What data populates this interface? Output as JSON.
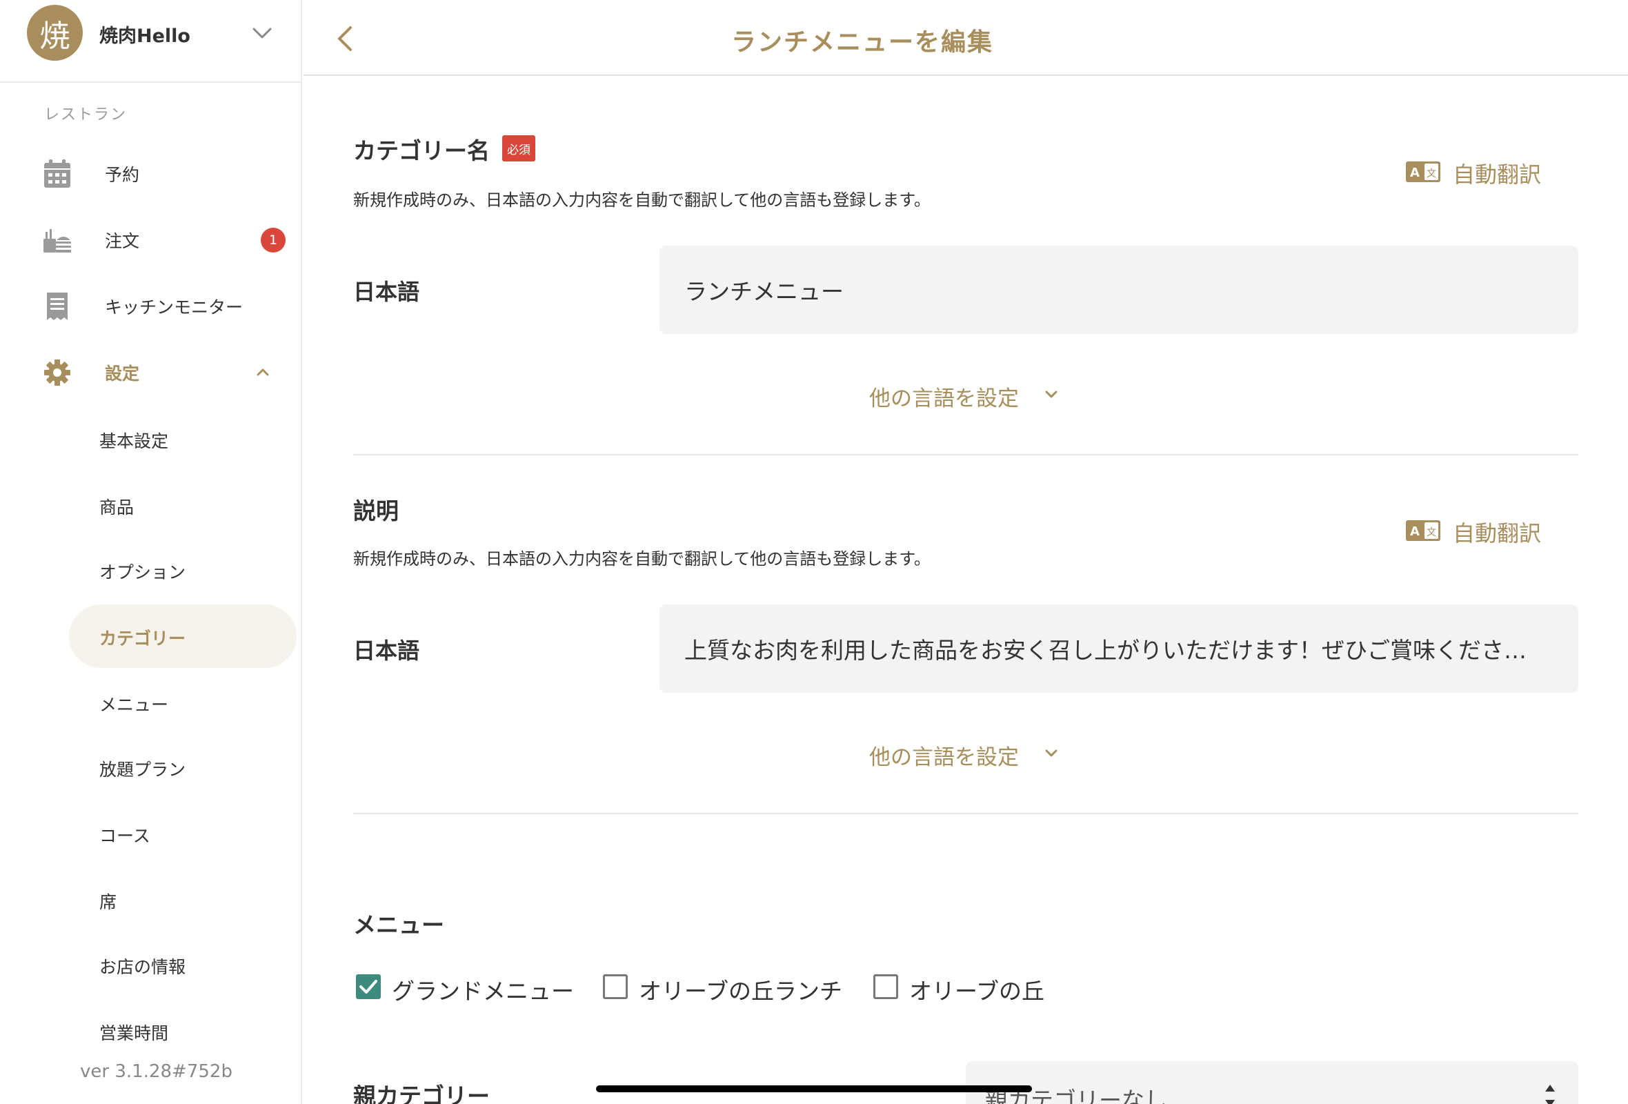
{
  "sidebar": {
    "avatar_char": "焼",
    "store_name": "焼肉Hello",
    "section_label": "レストラン",
    "nav": [
      {
        "label": "予約",
        "icon": "calendar-icon"
      },
      {
        "label": "注文",
        "icon": "order-icon",
        "badge": "1"
      },
      {
        "label": "キッチンモニター",
        "icon": "receipt-icon"
      },
      {
        "label": "設定",
        "icon": "gear-icon"
      }
    ],
    "settings_items": [
      {
        "label": "基本設定"
      },
      {
        "label": "商品"
      },
      {
        "label": "オプション"
      },
      {
        "label": "カテゴリー",
        "active": true
      },
      {
        "label": "メニュー"
      },
      {
        "label": "放題プラン"
      },
      {
        "label": "コース"
      },
      {
        "label": "席"
      },
      {
        "label": "お店の情報"
      },
      {
        "label": "営業時間"
      }
    ],
    "version": "ver 3.1.28#752b"
  },
  "header": {
    "title": "ランチメニューを編集"
  },
  "category_name": {
    "title": "カテゴリー名",
    "required_badge": "必須",
    "helper": "新規作成時のみ、日本語の入力内容を自動で翻訳して他の言語も登録します。",
    "translate_label": "自動翻訳",
    "field_label": "日本語",
    "value": "ランチメニュー",
    "other_lang": "他の言語を設定"
  },
  "description": {
    "title": "説明",
    "helper": "新規作成時のみ、日本語の入力内容を自動で翻訳して他の言語も登録します。",
    "translate_label": "自動翻訳",
    "field_label": "日本語",
    "value": "上質なお肉を利用した商品をお安く召し上がりいただけます！ぜひご賞味くださ…",
    "other_lang": "他の言語を設定"
  },
  "menu": {
    "title": "メニュー",
    "options": [
      {
        "label": "グランドメニュー",
        "checked": true
      },
      {
        "label": "オリーブの丘ランチ",
        "checked": false
      },
      {
        "label": "オリーブの丘",
        "checked": false
      }
    ]
  },
  "parent_category": {
    "title": "親カテゴリー",
    "selected": "親カテゴリーなし"
  },
  "colors": {
    "accent": "#a78e5c",
    "badge_red": "#d9473a",
    "checkbox_green": "#3d8b7d"
  }
}
